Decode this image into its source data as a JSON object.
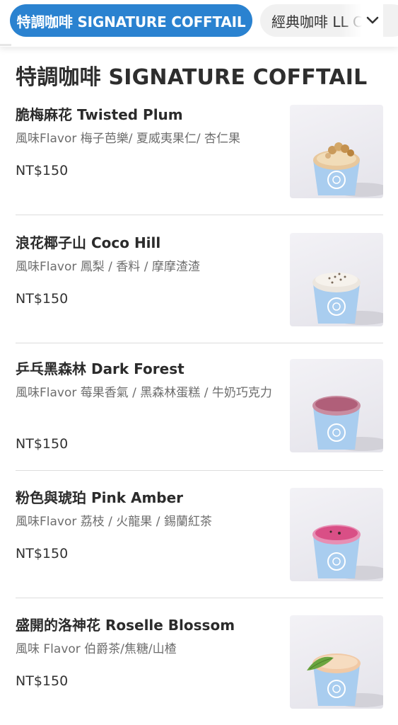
{
  "tabs": {
    "active_label": "特調咖啡 SIGNATURE COFFTAIL",
    "inactive_label": "經典咖啡 LL C",
    "chevron_icon": "chevron-down-icon"
  },
  "section": {
    "title": "特調咖啡 SIGNATURE COFFTAIL"
  },
  "items": [
    {
      "name": "脆梅麻花 Twisted Plum",
      "flavor": "風味Flavor 梅子芭樂/ 夏威夷果仁/ 杏仁果",
      "price": "NT$150",
      "image_icon": "cup-with-pretzel-topping"
    },
    {
      "name": "浪花椰子山 Coco Hill",
      "flavor": "風味Flavor 鳳梨 / 香料 / 摩摩渣渣",
      "price": "NT$150",
      "image_icon": "cup-with-foam-spice-topping"
    },
    {
      "name": "乒乓黑森林 Dark Forest",
      "flavor": "風味Flavor 莓果香氣 / 黑森林蛋糕 / 牛奶巧克力",
      "price": "NT$150",
      "image_icon": "cup-with-berry-topping"
    },
    {
      "name": "粉色與琥珀 Pink Amber",
      "flavor": "風味Flavor 荔枝 / 火龍果 / 錫蘭紅茶",
      "price": "NT$150",
      "image_icon": "cup-with-pink-topping"
    },
    {
      "name": "盛開的洛神花 Roselle Blossom",
      "flavor": "風味 Flavor 伯爵茶/焦糖/山楂",
      "price": "NT$150",
      "image_icon": "cup-with-leaf-garnish"
    }
  ],
  "colors": {
    "accent": "#2a82d0",
    "cup": "#a9cdef",
    "pink_topping": "#d94f86",
    "berry_topping": "#b05f79",
    "leaf": "#6aa53f"
  }
}
